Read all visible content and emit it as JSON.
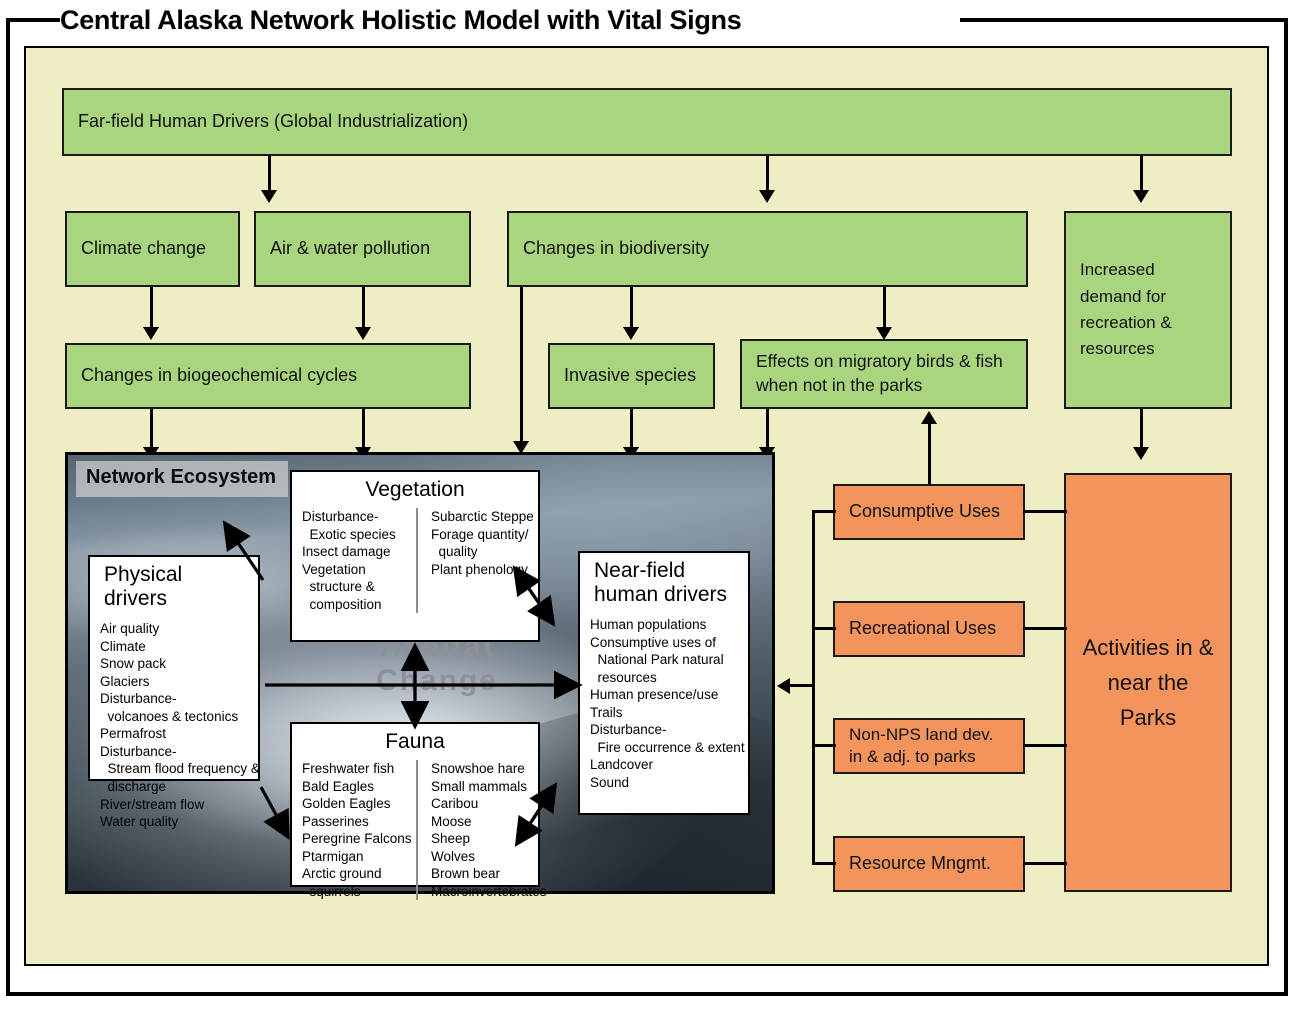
{
  "title": "Central Alaska Network Holistic Model with Vital Signs",
  "colors": {
    "green": "#a9d57e",
    "orange": "#f2945c",
    "cream": "#eeedc3",
    "border": "#000000",
    "panel": "#ffffff"
  },
  "drivers": {
    "far_field": "Far-field Human Drivers  (Global Industrialization)",
    "climate_change": "Climate change",
    "air_water_pollution": "Air & water pollution",
    "changes_biodiversity": "Changes in biodiversity",
    "increased_demand": "Increased demand for recreation & resources",
    "biogeochemical": "Changes in biogeochemical cycles",
    "invasive_species": "Invasive species",
    "migratory": "Effects on migratory birds & fish when not in the parks"
  },
  "ecosystem": {
    "label": "Network Ecosystem",
    "watermark": "Habitat Change",
    "physical_drivers": {
      "heading": "Physical drivers",
      "items": [
        "Air quality",
        "Climate",
        "Snow pack",
        "Glaciers",
        "Disturbance-",
        "  volcanoes & tectonics",
        "Permafrost",
        "Disturbance-",
        "  Stream flood frequency &",
        "  discharge",
        "River/stream flow",
        "Water quality"
      ]
    },
    "vegetation": {
      "heading": "Vegetation",
      "col1": [
        "Disturbance-",
        "  Exotic species",
        "Insect damage",
        "Vegetation",
        "  structure &",
        "  composition"
      ],
      "col2": [
        "Subarctic Steppe",
        "Forage quantity/",
        "  quality",
        "Plant phenology"
      ]
    },
    "fauna": {
      "heading": "Fauna",
      "col1": [
        "Freshwater fish",
        "Bald Eagles",
        "Golden Eagles",
        "Passerines",
        "Peregrine Falcons",
        "Ptarmigan",
        "Arctic ground",
        "  squirrels"
      ],
      "col2": [
        "Snowshoe hare",
        "Small mammals",
        "Caribou",
        "Moose",
        "Sheep",
        "Wolves",
        "Brown bear",
        "Macroinvertebrates"
      ]
    },
    "near_field": {
      "heading": "Near-field human drivers",
      "items": [
        "Human populations",
        "Consumptive uses of",
        "  National Park natural",
        "  resources",
        "Human presence/use",
        "Trails",
        "Disturbance-",
        "  Fire occurrence & extent",
        "Landcover",
        "Sound"
      ]
    }
  },
  "uses": {
    "consumptive": "Consumptive Uses",
    "recreational": "Recreational Uses",
    "non_nps": "Non-NPS land dev. in & adj. to parks",
    "resource_mngmt": "Resource Mngmt.",
    "activities": "Activities in & near the Parks"
  }
}
